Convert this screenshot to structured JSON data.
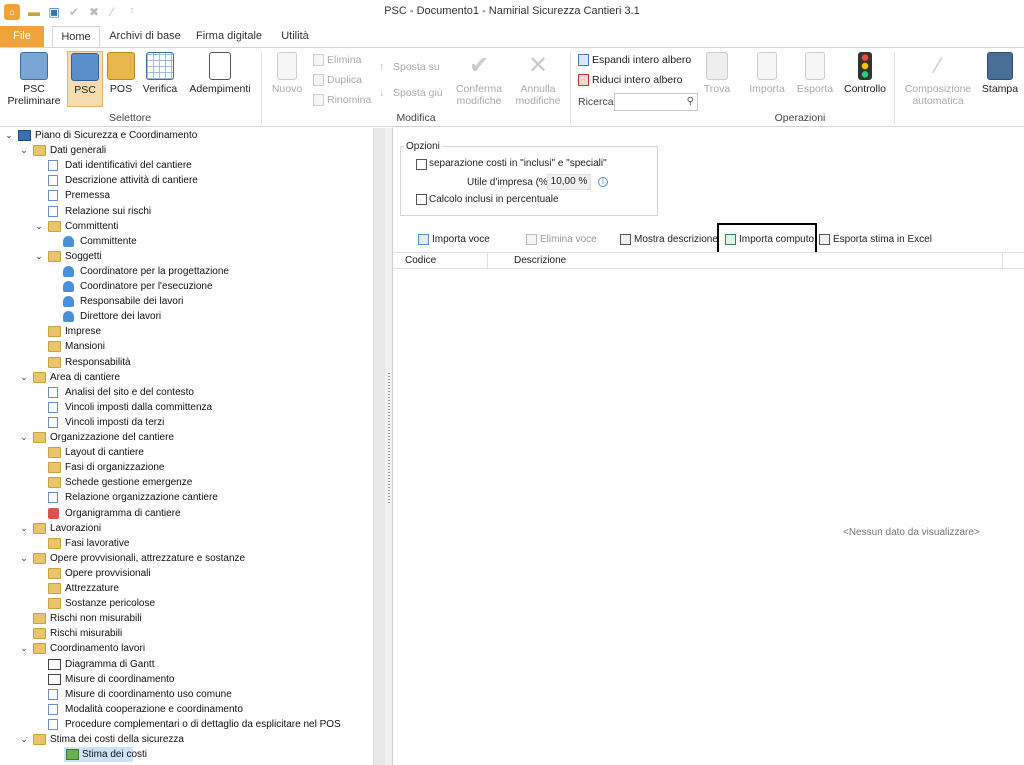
{
  "window": {
    "title": "PSC - Documento1 - Namirial Sicurezza Cantieri 3.1",
    "quick_access": [
      "app-icon",
      "open-icon",
      "save-icon",
      "check-icon",
      "cancel-icon",
      "wand-icon",
      "pin-icon"
    ]
  },
  "ribbon": {
    "tabs": [
      "File",
      "Home",
      "Archivi di base",
      "Firma digitale",
      "Utilità"
    ],
    "active_tab": "Home",
    "selettore": {
      "label": "Selettore",
      "buttons": [
        "PSC\nPreliminare",
        "PSC",
        "POS",
        "Verifica",
        "Adempimenti"
      ],
      "psc_prelim": "PSC",
      "psc_prelim2": "Preliminare",
      "selected": "PSC"
    },
    "modifica": {
      "label": "Modifica",
      "nuovo": "Nuovo",
      "elimina": "Elimina",
      "duplica": "Duplica",
      "rinomina": "Rinomina",
      "sposta_su": "Sposta su",
      "sposta_giu": "Sposta giù",
      "conferma1": "Conferma",
      "conferma2": "modifiche",
      "annulla1": "Annulla",
      "annulla2": "modifiche"
    },
    "operazioni": {
      "label": "Operazioni",
      "espandi": "Espandi intero albero",
      "riduci": "Riduci intero albero",
      "ricerca": "Ricerca",
      "trova": "Trova",
      "importa": "Importa",
      "esporta": "Esporta",
      "controllo": "Controllo",
      "composizione1": "Composizione",
      "composizione2": "automatica",
      "stampa": "Stampa"
    }
  },
  "tree": [
    {
      "level": 0,
      "label": "Piano di Sicurezza e Coordinamento",
      "icon": "pcs",
      "exp": "v"
    },
    {
      "level": 1,
      "label": "Dati generali",
      "icon": "folder",
      "exp": "v"
    },
    {
      "level": 2,
      "label": "Dati identificativi del cantiere",
      "icon": "doc"
    },
    {
      "level": 2,
      "label": "Descrizione attività di cantiere",
      "icon": "doc"
    },
    {
      "level": 2,
      "label": "Premessa",
      "icon": "doc"
    },
    {
      "level": 2,
      "label": "Relazione sui rischi",
      "icon": "doc"
    },
    {
      "level": 2,
      "label": "Committenti",
      "icon": "folder",
      "exp": "v"
    },
    {
      "level": 3,
      "label": "Committente",
      "icon": "person"
    },
    {
      "level": 2,
      "label": "Soggetti",
      "icon": "folder",
      "exp": "v"
    },
    {
      "level": 3,
      "label": "Coordinatore per la progettazione",
      "icon": "person"
    },
    {
      "level": 3,
      "label": "Coordinatore per l'esecuzione",
      "icon": "person"
    },
    {
      "level": 3,
      "label": "Responsabile dei lavori",
      "icon": "person"
    },
    {
      "level": 3,
      "label": "Direttore dei lavori",
      "icon": "person"
    },
    {
      "level": 2,
      "label": "Imprese",
      "icon": "folder"
    },
    {
      "level": 2,
      "label": "Mansioni",
      "icon": "folder"
    },
    {
      "level": 2,
      "label": "Responsabilità",
      "icon": "folder"
    },
    {
      "level": 1,
      "label": "Area di cantiere",
      "icon": "folder",
      "exp": "v"
    },
    {
      "level": 2,
      "label": "Analisi del sito e del contesto",
      "icon": "doc"
    },
    {
      "level": 2,
      "label": "Vincoli imposti dalla committenza",
      "icon": "doc"
    },
    {
      "level": 2,
      "label": "Vincoli imposti da terzi",
      "icon": "doc"
    },
    {
      "level": 1,
      "label": "Organizzazione del cantiere",
      "icon": "folder",
      "exp": "v"
    },
    {
      "level": 2,
      "label": "Layout di cantiere",
      "icon": "folder"
    },
    {
      "level": 2,
      "label": "Fasi di organizzazione",
      "icon": "folder"
    },
    {
      "level": 2,
      "label": "Schede gestione emergenze",
      "icon": "folder"
    },
    {
      "level": 2,
      "label": "Relazione organizzazione cantiere",
      "icon": "doc"
    },
    {
      "level": 2,
      "label": "Organigramma di cantiere",
      "icon": "orgchart"
    },
    {
      "level": 1,
      "label": "Lavorazioni",
      "icon": "folder",
      "exp": "v"
    },
    {
      "level": 2,
      "label": "Fasi lavorative",
      "icon": "folder"
    },
    {
      "level": 1,
      "label": "Opere provvisionali, attrezzature e sostanze",
      "icon": "folder",
      "exp": "v"
    },
    {
      "level": 2,
      "label": "Opere provvisionali",
      "icon": "folder"
    },
    {
      "level": 2,
      "label": "Attrezzature",
      "icon": "folder"
    },
    {
      "level": 2,
      "label": "Sostanze pericolose",
      "icon": "folder"
    },
    {
      "level": 1,
      "label": "Rischi non misurabili",
      "icon": "folder"
    },
    {
      "level": 1,
      "label": "Rischi misurabili",
      "icon": "folder"
    },
    {
      "level": 1,
      "label": "Coordinamento lavori",
      "icon": "folder",
      "exp": "v"
    },
    {
      "level": 2,
      "label": "Diagramma di Gantt",
      "icon": "gantt"
    },
    {
      "level": 2,
      "label": "Misure di coordinamento",
      "icon": "gantt"
    },
    {
      "level": 2,
      "label": "Misure di coordinamento uso comune",
      "icon": "doc"
    },
    {
      "level": 2,
      "label": "Modalità cooperazione e coordinamento",
      "icon": "doc"
    },
    {
      "level": 2,
      "label": "Procedure complementari o di dettaglio da esplicitare nel POS",
      "icon": "doc"
    },
    {
      "level": 1,
      "label": "Stima dei costi della sicurezza",
      "icon": "folder",
      "exp": "v"
    },
    {
      "level": 2,
      "label": "Stima dei costi",
      "icon": "money",
      "selected": true
    }
  ],
  "options": {
    "title": "Opzioni",
    "separazione": "separazione costi in \"inclusi\" e \"speciali\"",
    "utile_label": "Utile d'impresa (%)",
    "utile_value": "10,00 %",
    "calcolo": "Calcolo inclusi in percentuale"
  },
  "toolbar": {
    "importa_voce": "Importa voce",
    "elimina_voce": "Elimina voce",
    "mostra_descrizione": "Mostra descrizione",
    "importa_computo": "Importa computo",
    "esporta_stima": "Esporta stima in Excel"
  },
  "grid": {
    "columns": [
      "Codice",
      "Descrizione"
    ],
    "empty_text": "<Nessun dato da visualizzare>"
  }
}
